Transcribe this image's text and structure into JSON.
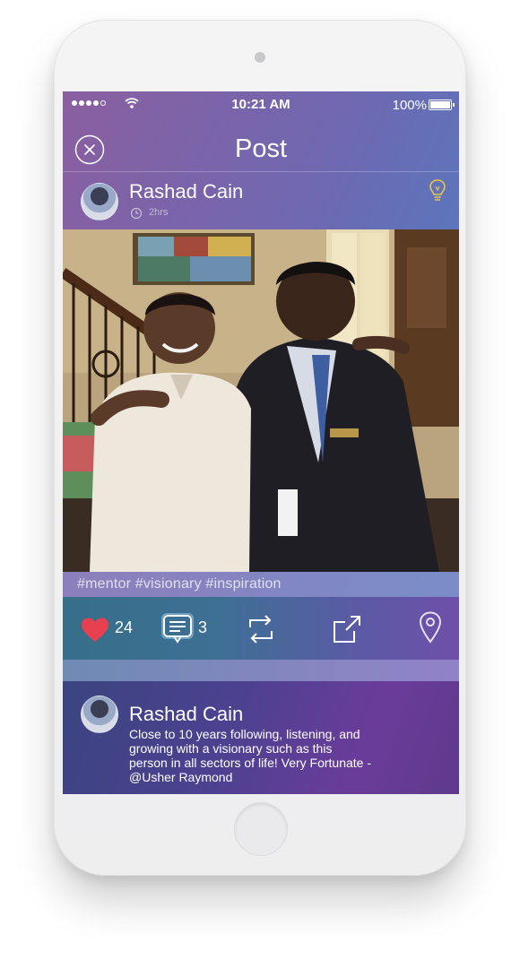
{
  "status_bar": {
    "time": "10:21 AM",
    "battery": "100%"
  },
  "header": {
    "title": "Post"
  },
  "post": {
    "author": "Rashad Cain",
    "time_ago": "2hrs",
    "tags": "#mentor #visionary #inspiration",
    "likes": "24",
    "comments": "3"
  },
  "comment": {
    "author": "Rashad Cain",
    "text": "Close to 10 years following, listening, and growing with a visionary such as this person in all sectors of life! Very Fortunate - ",
    "mention": "@Usher Raymond"
  },
  "colors": {
    "accent_like": "#e8404f",
    "bulb": "#e9c64a"
  },
  "icons": [
    "close-icon",
    "clock-icon",
    "lightbulb-icon",
    "heart-icon",
    "comment-icon",
    "repost-icon",
    "share-icon",
    "location-pin-icon",
    "wifi-icon"
  ]
}
